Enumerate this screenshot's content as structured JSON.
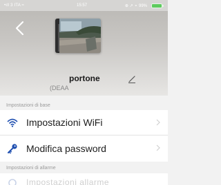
{
  "status_bar": {
    "left": "•ıll 3 ITA ≈",
    "time": "15:57",
    "right": "⊕ ↗ ⚬ 99%"
  },
  "device": {
    "name": "portone",
    "id": "(DEAA"
  },
  "sections": {
    "basic": "Impostazioni di base",
    "alarm": "Impostazioni di allarme"
  },
  "rows": {
    "wifi": "Impostazioni WiFi",
    "password": "Modifica password",
    "next": "Impostazioni allarme"
  },
  "icons": {
    "back": "back-arrow-icon",
    "edit": "pencil-icon",
    "wifi": "wifi-icon",
    "password": "key-icon",
    "chevron": "chevron-right-icon"
  },
  "colors": {
    "accent": "#1f4fb0",
    "status_green": "#5ecb5e"
  }
}
